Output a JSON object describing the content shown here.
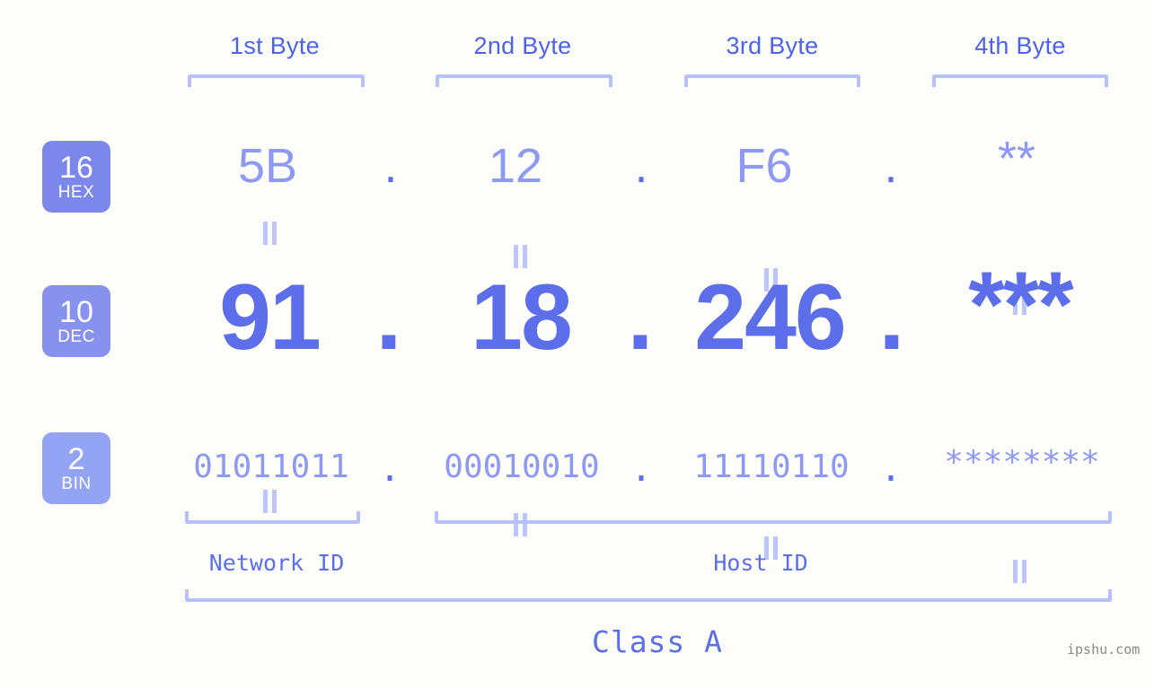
{
  "background_color": "#fdfefa",
  "accent_color": "#5c6ee9",
  "accent_light_color": "#8d99f3",
  "bracket_color": "#b6c0fb",
  "byte_headers": [
    {
      "label": "1st Byte"
    },
    {
      "label": "2nd Byte"
    },
    {
      "label": "3rd Byte"
    },
    {
      "label": "4th Byte"
    }
  ],
  "radix_badges": [
    {
      "number": "16",
      "name": "HEX",
      "color": "#7b87ea"
    },
    {
      "number": "10",
      "name": "DEC",
      "color": "#8792ef"
    },
    {
      "number": "2",
      "name": "BIN",
      "color": "#93a4f5"
    }
  ],
  "separator": ".",
  "rows": {
    "hex": {
      "values": [
        "5B",
        "12",
        "F6",
        "**"
      ]
    },
    "dec": {
      "values": [
        "91",
        "18",
        "246",
        "***"
      ]
    },
    "bin": {
      "values": [
        "01011011",
        "00010010",
        "11110110",
        "********"
      ]
    }
  },
  "segments": {
    "network_id": "Network ID",
    "host_id": "Host ID",
    "class": "Class A"
  },
  "watermark": "ipshu.com"
}
